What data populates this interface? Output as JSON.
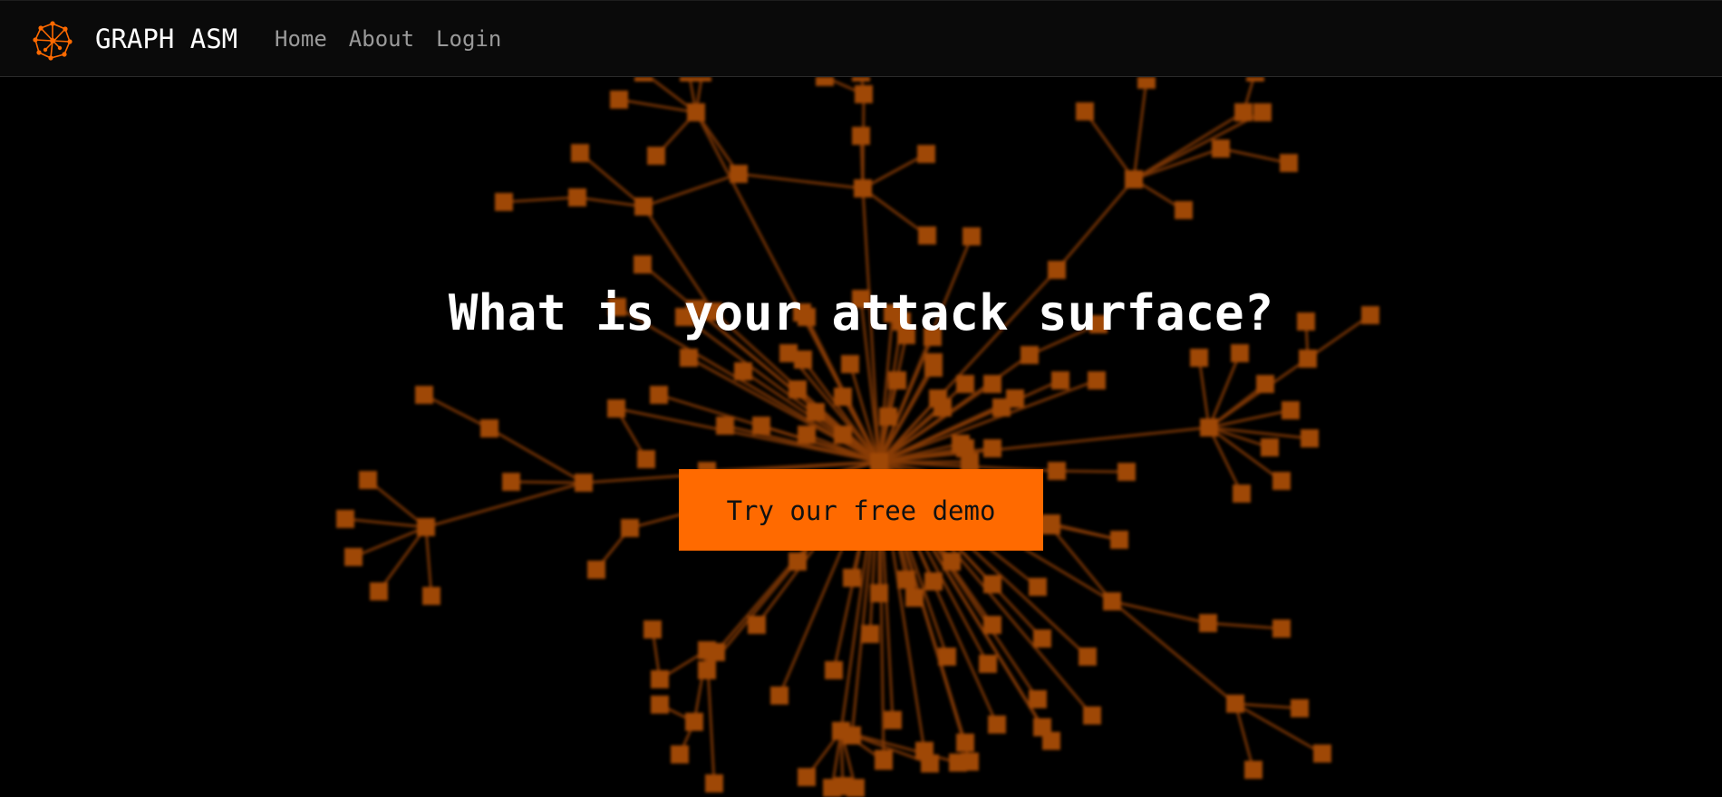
{
  "navbar": {
    "brand": "GRAPH ASM",
    "logo_icon": "graph-network-icon",
    "links": [
      {
        "label": "Home"
      },
      {
        "label": "About"
      },
      {
        "label": "Login"
      }
    ]
  },
  "hero": {
    "title": "What is your attack surface?",
    "cta_label": "Try our free demo",
    "background": "network-graph-illustration"
  },
  "colors": {
    "accent": "#ff6a00",
    "node": "#c35808",
    "background": "#000000",
    "navbar": "#0a0a0a",
    "nav_link": "#9a9a9a"
  }
}
